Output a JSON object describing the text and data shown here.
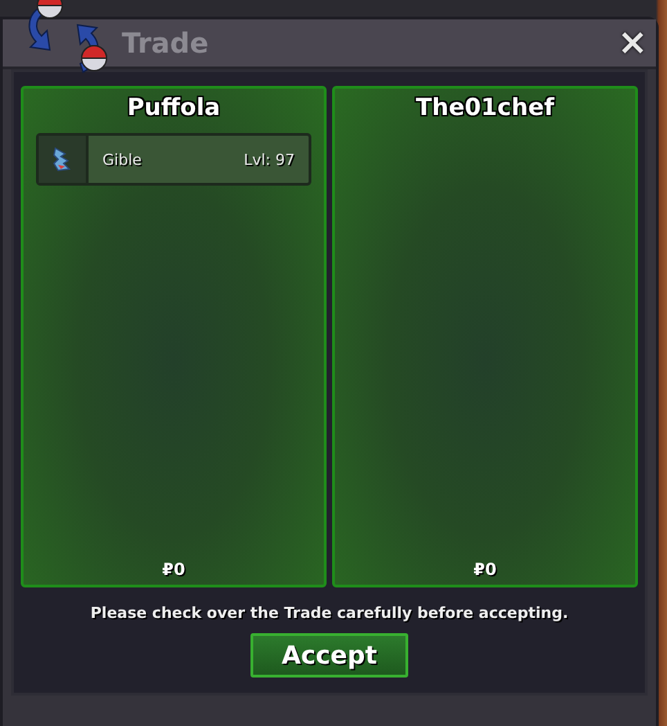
{
  "window": {
    "title": "Trade",
    "close": "×"
  },
  "panels": [
    {
      "trainer": "Puffola",
      "items": [
        {
          "name": "Gible",
          "level": "Lvl: 97"
        }
      ],
      "money": "₽0"
    },
    {
      "trainer": "The01chef",
      "money": "₽0"
    }
  ],
  "notice": "Please check over the Trade carefully before accepting.",
  "accept_button": "Accept"
}
